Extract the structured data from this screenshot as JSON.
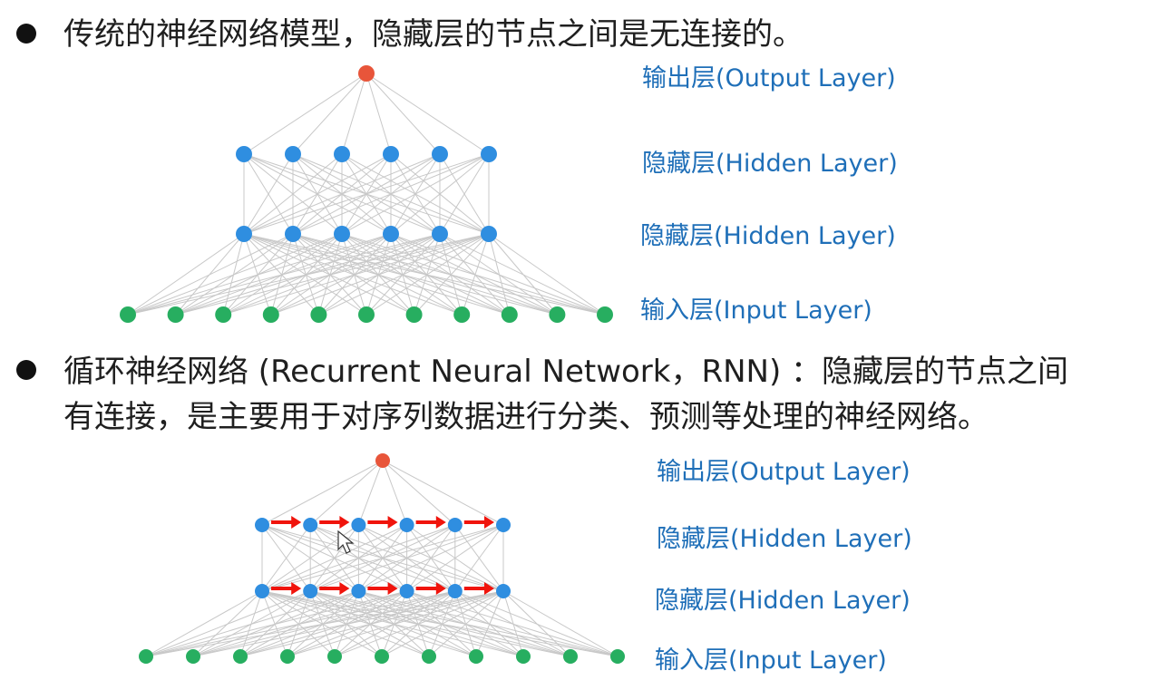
{
  "bullets": {
    "first": "传统的神经网络模型，隐藏层的节点之间是无连接的。",
    "second_line1": "循环神经网络 (Recurrent Neural Network，RNN) ：隐藏层的节点之间",
    "second_line2": "有连接，是主要用于对序列数据进行分类、预测等处理的神经网络。"
  },
  "diagram1": {
    "labels": {
      "output": "输出层(Output Layer)",
      "hidden1": "隐藏层(Hidden Layer)",
      "hidden2": "隐藏层(Hidden Layer)",
      "input": "输入层(Input Layer)"
    }
  },
  "diagram2": {
    "labels": {
      "output": "输出层(Output Layer)",
      "hidden1": "隐藏层(Hidden Layer)",
      "hidden2": "隐藏层(Hidden Layer)",
      "input": "输入层(Input Layer)"
    }
  },
  "colors": {
    "output_node": "#e8553a",
    "hidden_node": "#2f8ee0",
    "input_node": "#27ae60",
    "edge": "#c8c8c8",
    "recurrent_arrow": "#f0140c",
    "label": "#1f6fb8"
  },
  "network": {
    "output_nodes": 1,
    "hidden_nodes_per_layer": 6,
    "input_nodes": 11
  }
}
